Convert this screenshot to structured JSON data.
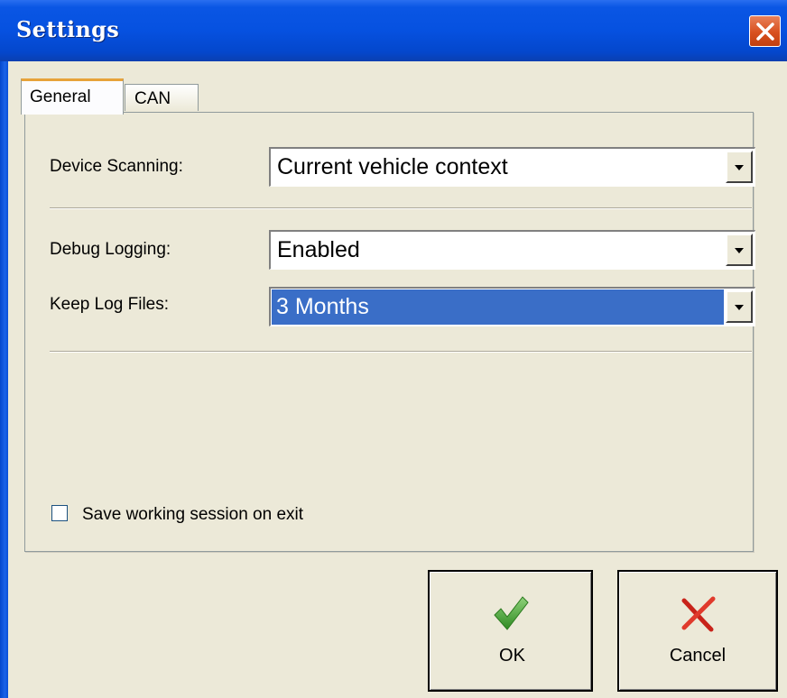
{
  "window": {
    "title": "Settings"
  },
  "tabs": [
    {
      "label": "General",
      "active": true
    },
    {
      "label": "CAN",
      "active": false
    }
  ],
  "general": {
    "device_scanning": {
      "label": "Device Scanning:",
      "value": "Current vehicle context"
    },
    "debug_logging": {
      "label": "Debug Logging:",
      "value": "Enabled"
    },
    "keep_log_files": {
      "label": "Keep Log Files:",
      "value": "3 Months"
    },
    "save_session": {
      "label": "Save working session on exit",
      "checked": false
    }
  },
  "buttons": {
    "ok_label": "OK",
    "cancel_label": "Cancel"
  },
  "icons": {
    "close": "close-icon",
    "ok": "checkmark-icon",
    "cancel": "x-mark-icon"
  },
  "colors": {
    "titlebar": "#0651e0",
    "close_button": "#d8501e",
    "selection": "#3a6ec7",
    "ok_icon": "#2f9a2a",
    "cancel_icon": "#d42a1e",
    "active_tab_accent": "#e7a33a"
  }
}
